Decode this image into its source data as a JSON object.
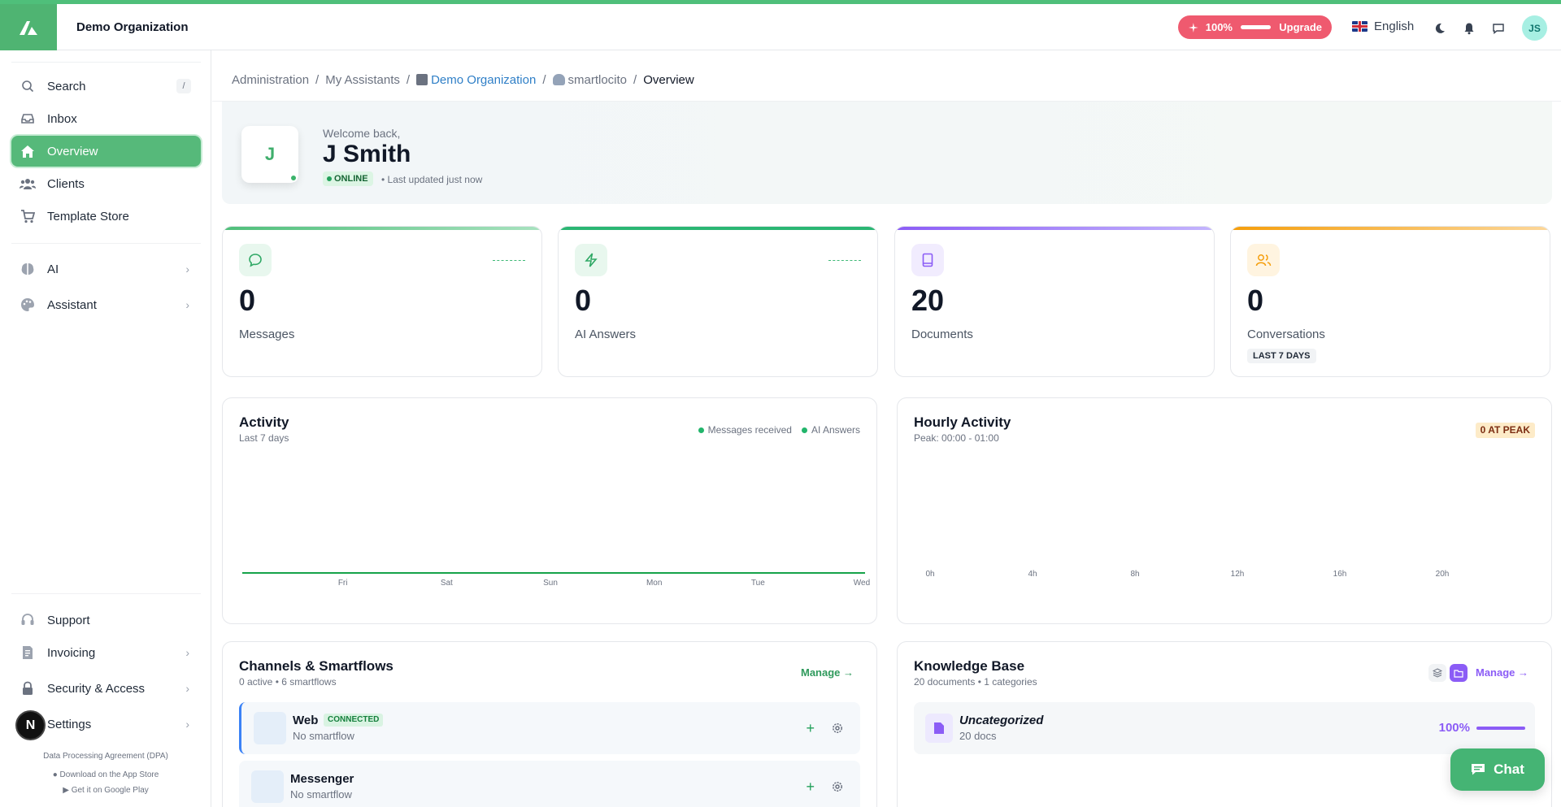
{
  "header": {
    "org_name": "Demo Organization",
    "usage_percent": "100%",
    "upgrade_label": "Upgrade",
    "language": "English",
    "user_initials": "JS"
  },
  "sidebar": {
    "search_label": "Search",
    "search_shortcut": "/",
    "items": [
      {
        "label": "Inbox"
      },
      {
        "label": "Overview"
      },
      {
        "label": "Clients"
      },
      {
        "label": "Template Store"
      },
      {
        "label": "AI"
      },
      {
        "label": "Assistant"
      }
    ],
    "bottom_items": [
      {
        "label": "Support"
      },
      {
        "label": "Invoicing"
      },
      {
        "label": "Security & Access"
      },
      {
        "label": "Settings"
      }
    ],
    "dpa": "Data Processing Agreement (DPA)",
    "app_store": "Download on the App Store",
    "google_play": "Get it on Google Play",
    "badge": "N"
  },
  "breadcrumb": {
    "items": [
      "Administration",
      "My Assistants",
      "Demo Organization",
      "smartlocito",
      "Overview"
    ],
    "separator": "/"
  },
  "welcome": {
    "avatar_initial": "J",
    "greeting": "Welcome back,",
    "name": "J Smith",
    "status": "ONLINE",
    "updated": "• Last updated just now"
  },
  "stats": [
    {
      "value": "0",
      "label": "Messages",
      "color": "#4fbf7a"
    },
    {
      "value": "0",
      "label": "AI Answers",
      "color": "#2bb673"
    },
    {
      "value": "20",
      "label": "Documents",
      "color": "#8b5cf6"
    },
    {
      "value": "0",
      "label": "Conversations",
      "color": "#f59e0b",
      "tag": "LAST 7 DAYS"
    }
  ],
  "activity": {
    "title": "Activity",
    "subtitle": "Last 7 days",
    "legend": [
      "Messages received",
      "AI Answers"
    ]
  },
  "hourly": {
    "title": "Hourly Activity",
    "subtitle": "Peak: 00:00 - 01:00",
    "badge": "0 AT PEAK"
  },
  "chart_data": [
    {
      "type": "line",
      "title": "Activity",
      "subtitle": "Last 7 days",
      "categories": [
        "Fri",
        "Sat",
        "Sun",
        "Mon",
        "Tue",
        "Wed"
      ],
      "series": [
        {
          "name": "Messages received",
          "values": [
            0,
            0,
            0,
            0,
            0,
            0
          ]
        },
        {
          "name": "AI Answers",
          "values": [
            0,
            0,
            0,
            0,
            0,
            0
          ]
        }
      ]
    },
    {
      "type": "bar",
      "title": "Hourly Activity",
      "subtitle": "Peak: 00:00 - 01:00",
      "categories": [
        "0h",
        "4h",
        "8h",
        "12h",
        "16h",
        "20h"
      ],
      "values": [
        0,
        0,
        0,
        0,
        0,
        0
      ]
    }
  ],
  "channels": {
    "title": "Channels & Smartflows",
    "subtitle": "0 active • 6 smartflows",
    "manage_label": "Manage →",
    "items": [
      {
        "name": "Web",
        "badge": "CONNECTED",
        "sub": "No smartflow"
      },
      {
        "name": "Messenger",
        "sub": "No smartflow"
      }
    ]
  },
  "knowledge": {
    "title": "Knowledge Base",
    "subtitle": "20 documents • 1 categories",
    "manage_label": "Manage →",
    "items": [
      {
        "name": "Uncategorized",
        "sub": "20 docs",
        "percent": "100%"
      }
    ]
  },
  "chat_button": "Chat",
  "colors": {
    "brand_green": "#4fb472",
    "accent_purple": "#8b5cf6",
    "upgrade_red": "#ef5a6f"
  }
}
